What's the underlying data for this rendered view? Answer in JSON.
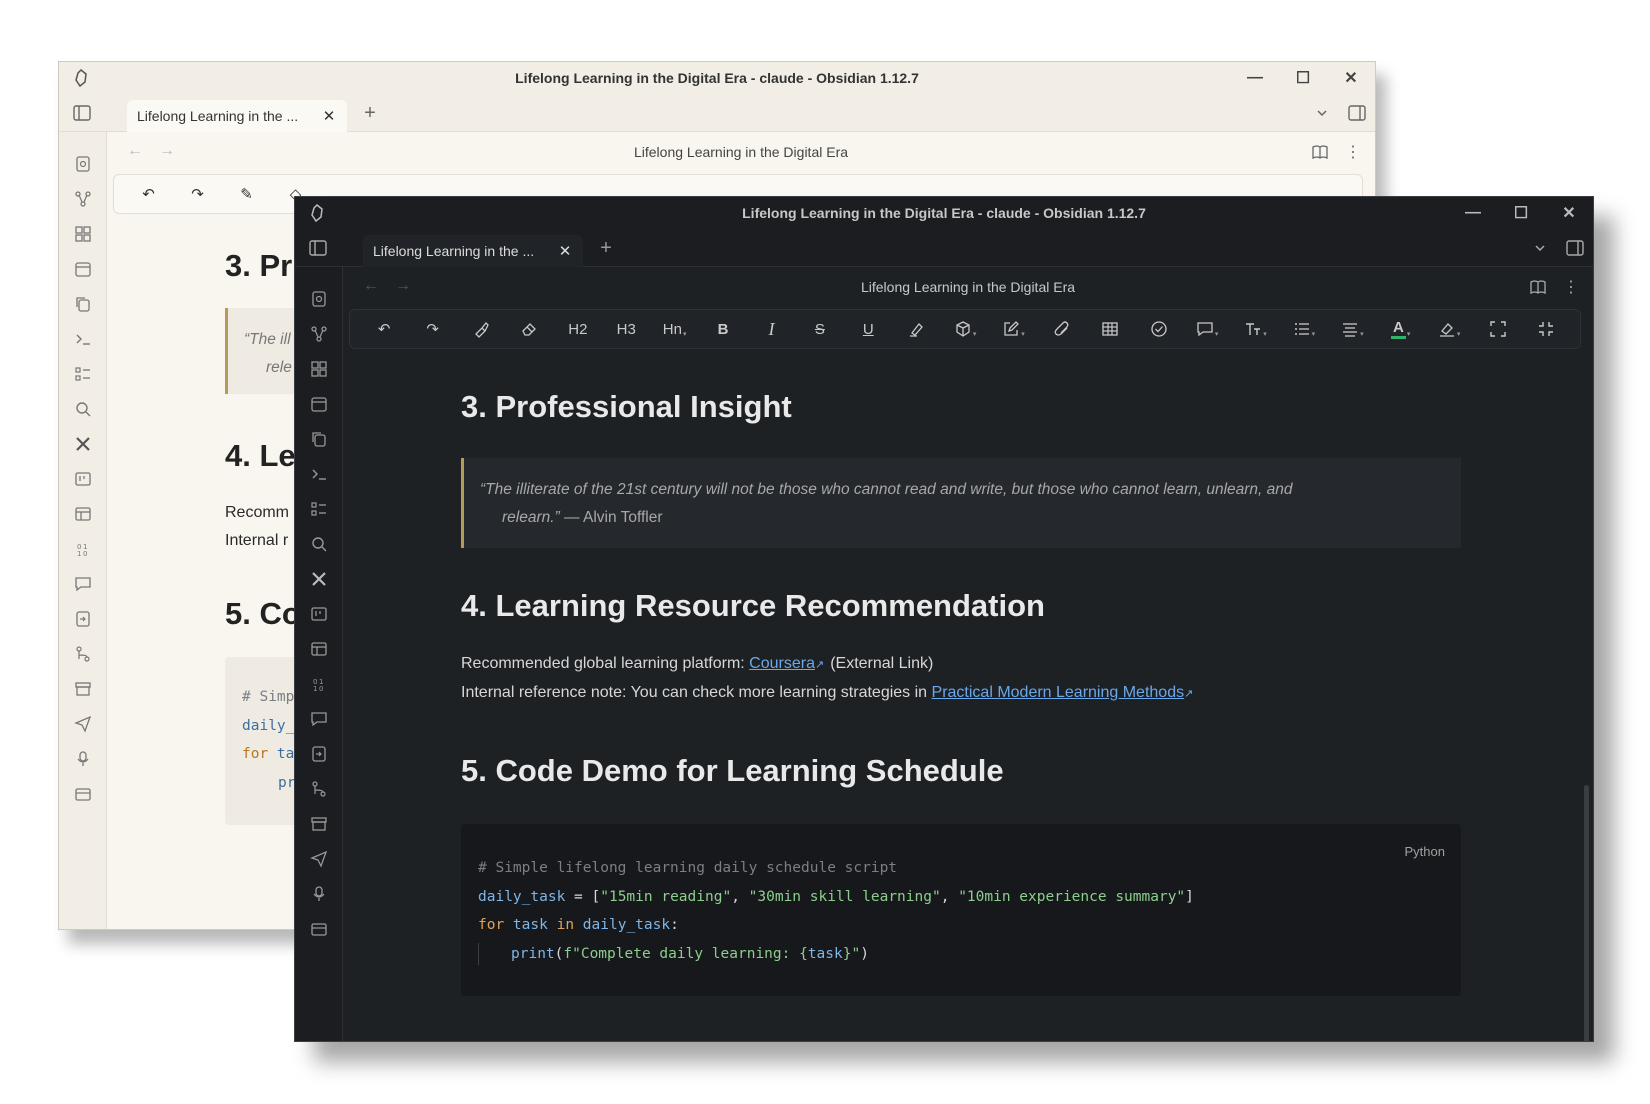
{
  "back_window": {
    "title": "Lifelong Learning in the Digital Era - claude - Obsidian 1.12.7",
    "tab_label": "Lifelong Learning in the ...",
    "note_title": "Lifelong Learning in the Digital Era",
    "visible_fragments": {
      "h3": "3. Pr",
      "quote_line1": "“The ill",
      "quote_line2": "rele",
      "h4": "4. Le",
      "para1": "Recomm",
      "para2": "Internal r",
      "h5": "5. Co",
      "code1": "# Simp",
      "code2": "daily_",
      "code3_kw": "for",
      "code3_rest": " ta",
      "code4": "pr"
    }
  },
  "front_window": {
    "title": "Lifelong Learning in the Digital Era - claude - Obsidian 1.12.7",
    "tab_label": "Lifelong Learning in the ...",
    "note_title": "Lifelong Learning in the Digital Era",
    "toolbar": {
      "h2": "H2",
      "h3": "H3",
      "hn": "Hn",
      "bold": "B",
      "italic": "I",
      "strike": "S",
      "underline": "U",
      "font_color": "A"
    },
    "doc": {
      "h3": "3. Professional Insight",
      "quote_line1": "“The illiterate of the 21st century will not be those who cannot read and write, but those who cannot learn, unlearn, and",
      "quote_line2": "relearn.”",
      "quote_author": " — Alvin Toffler",
      "h4": "4. Learning Resource Recommendation",
      "para1_prefix": "Recommended global learning platform: ",
      "para1_link": "Coursera",
      "para1_suffix": "(External Link)",
      "para2_prefix": "Internal reference note: You can check more learning strategies in ",
      "para2_link": "Practical Modern Learning Methods",
      "h5": "5. Code Demo for Learning Schedule",
      "code_lang": "Python",
      "code": {
        "comment": "# Simple lifelong learning daily schedule script",
        "l2_var": "daily_task",
        "l2_eq": " = [",
        "l2_s1": "\"15min reading\"",
        "l2_s2": "\"30min skill learning\"",
        "l2_s3": "\"10min experience summary\"",
        "l2_end": "]",
        "comma": ", ",
        "l3_for": "for",
        "l3_task": " task ",
        "l3_in": "in",
        "l3_iter": " daily_task",
        "l3_colon": ":",
        "l4_fn": "print",
        "l4_open": "(",
        "l4_str": "f\"Complete daily learning: {",
        "l4_var": "task",
        "l4_close_str": "}\"",
        "l4_close": ")"
      }
    }
  },
  "icons": [
    "obsidian-logo-icon",
    "sidebar-toggle-icon",
    "close-icon",
    "plus-icon",
    "chevron-down-icon",
    "right-sidebar-icon",
    "file-search-icon",
    "graph-icon",
    "grid-icon",
    "calendar-icon",
    "copy-icon",
    "terminal-icon",
    "checklist-icon",
    "search-icon",
    "tools-icon",
    "kanban-icon",
    "layout-icon",
    "sort-numbers-icon",
    "comment-icon",
    "import-icon",
    "git-branch-icon",
    "archive-icon",
    "send-icon",
    "microphone-icon",
    "add-list-icon",
    "book-icon",
    "more-vertical-icon",
    "undo-icon",
    "redo-icon",
    "format-painter-icon",
    "eraser-icon",
    "highlighter-icon",
    "cube-icon",
    "edit-icon",
    "paperclip-icon",
    "table-icon",
    "check-circle-icon",
    "callout-icon",
    "text-size-icon",
    "list-icon",
    "align-icon",
    "font-color-icon",
    "highlight-color-icon",
    "fullscreen-icon",
    "collapse-icon"
  ],
  "colors": {
    "dark_bg": "#1e2124",
    "light_bg": "#f9f6ef",
    "link": "#6aa8ea",
    "quote_border": "#b79a5a",
    "font_color_underline": "#2fb36b"
  }
}
